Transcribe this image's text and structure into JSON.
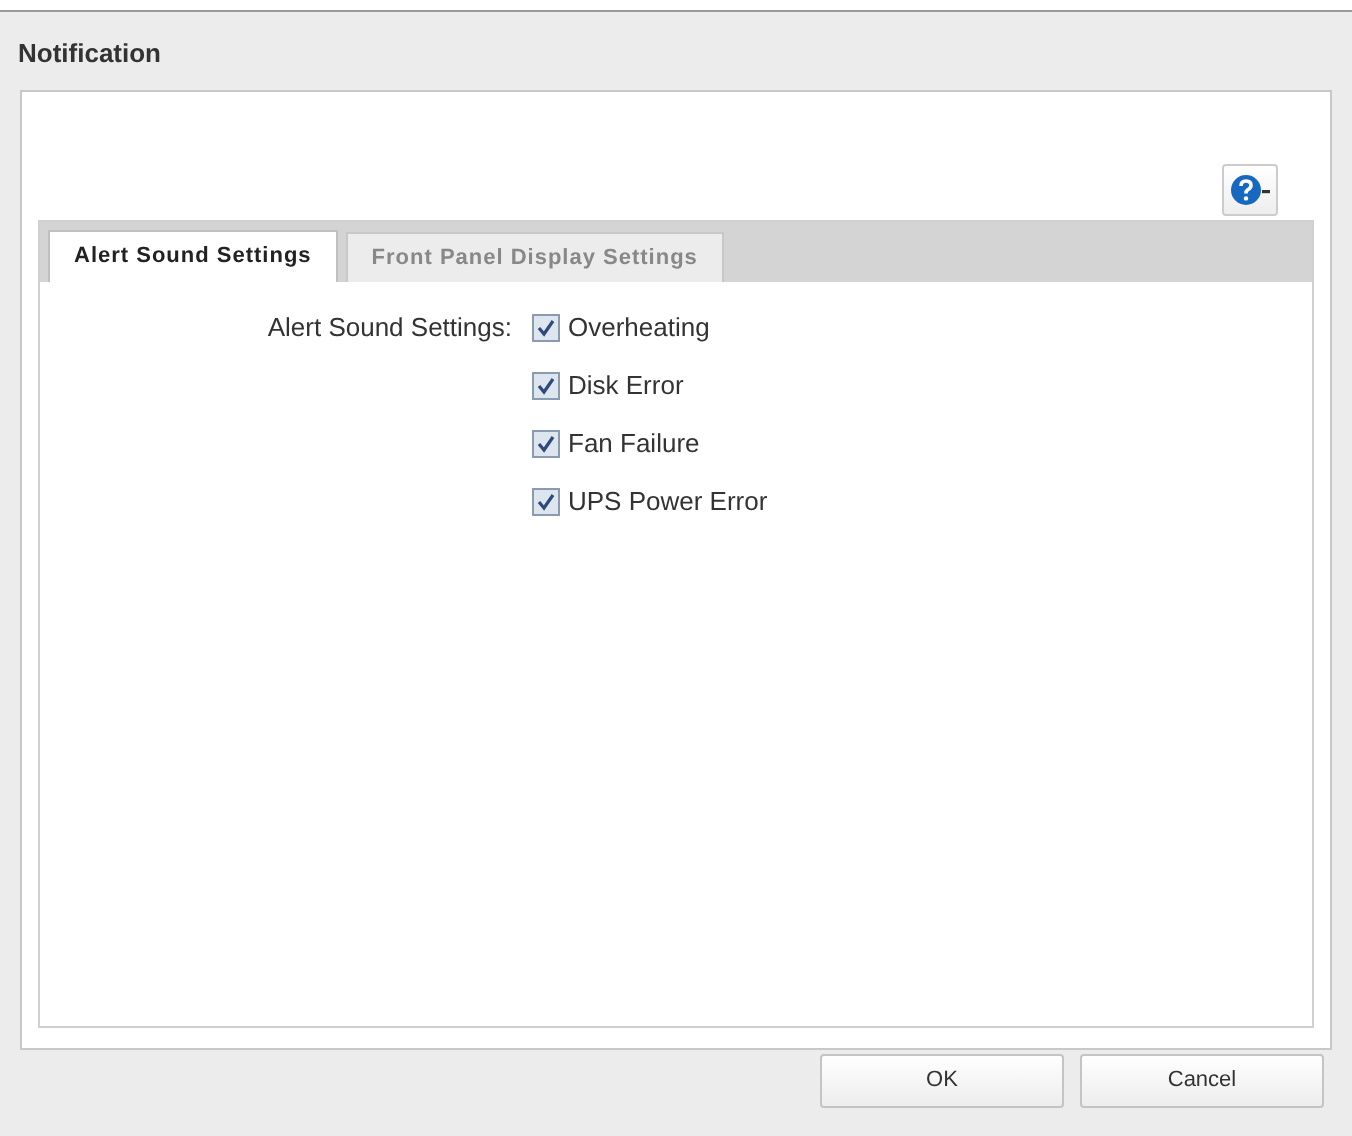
{
  "window": {
    "title": "Notification"
  },
  "tabs": [
    {
      "label": "Alert Sound Settings",
      "selected": true
    },
    {
      "label": "Front Panel Display Settings",
      "selected": false
    }
  ],
  "alert_sound": {
    "label": "Alert Sound Settings:",
    "options": [
      {
        "label": "Overheating",
        "checked": true
      },
      {
        "label": "Disk Error",
        "checked": true
      },
      {
        "label": "Fan Failure",
        "checked": true
      },
      {
        "label": "UPS Power Error",
        "checked": true
      }
    ]
  },
  "buttons": [
    {
      "label": "OK"
    },
    {
      "label": "Cancel"
    }
  ]
}
